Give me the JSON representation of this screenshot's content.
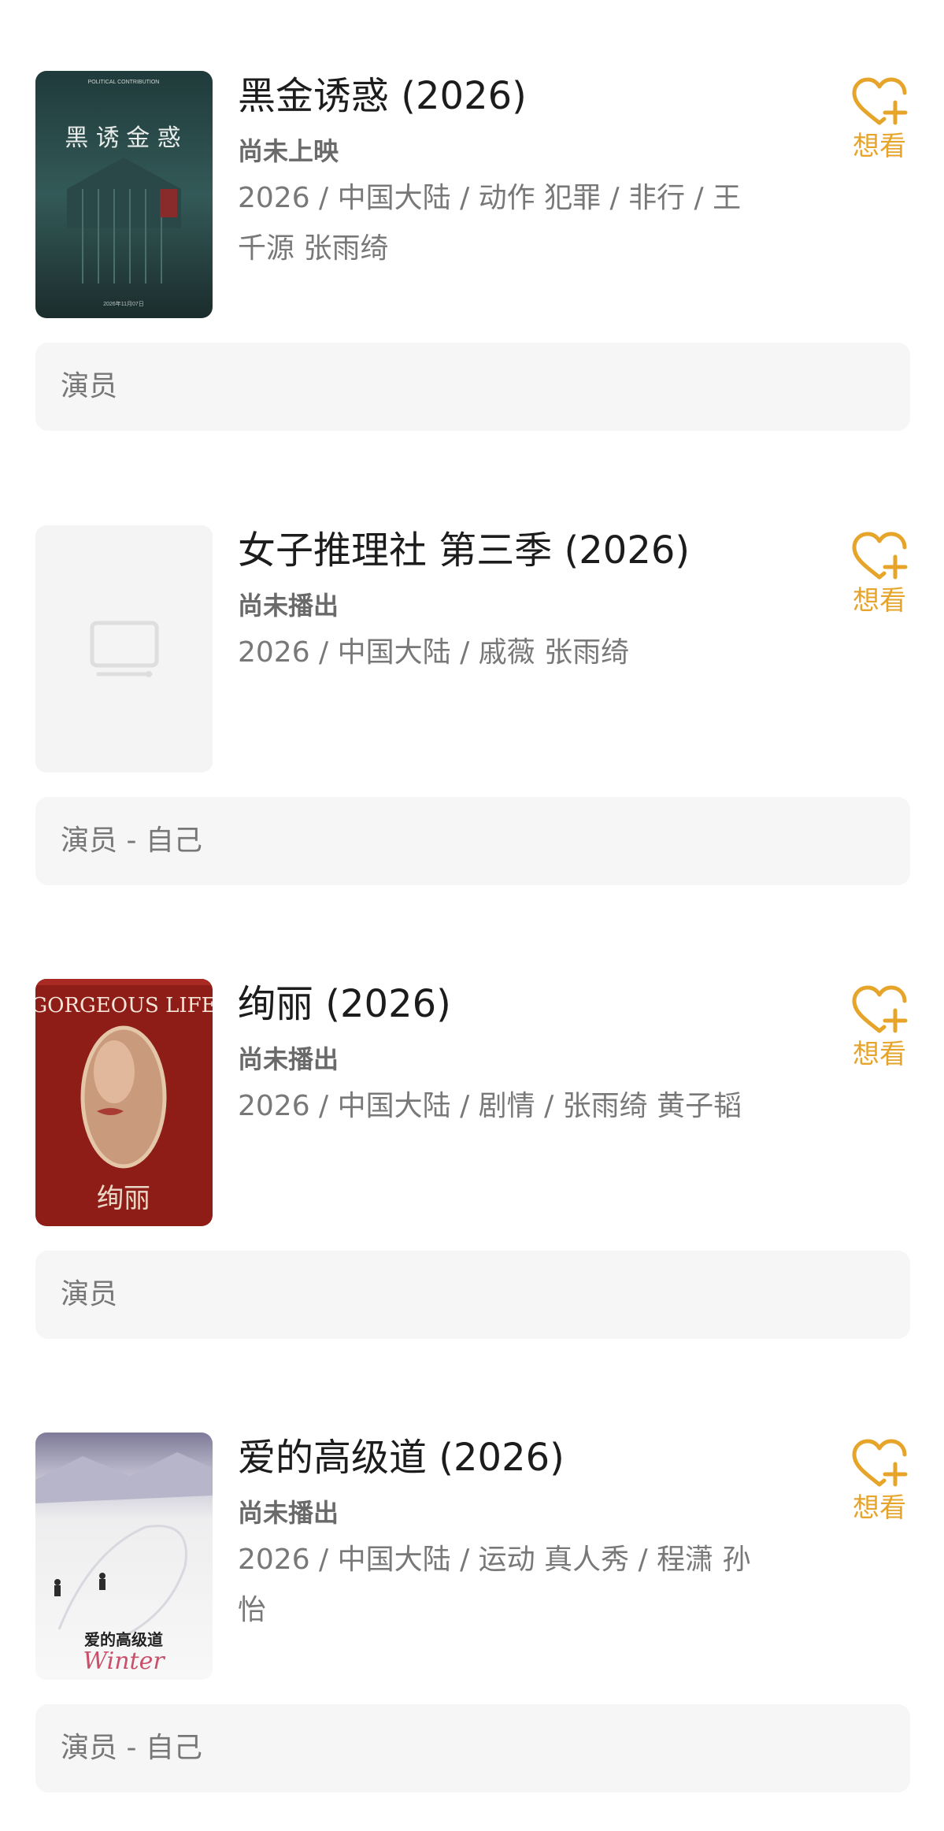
{
  "want_label": "想看",
  "accent_color": "#e6a52a",
  "works": [
    {
      "title": "黑金诱惑 (2026)",
      "status": "尚未上映",
      "info": "2026 / 中国大陆 / 动作 犯罪 / 非行 / 王千源 张雨绮",
      "role": "演员",
      "poster": "dark teal movie poster",
      "poster_text": {
        "top": "POLITICAL CONTRIBUTION",
        "title_left": "黑 诱",
        "title_right": "金 惑",
        "date": "2026年11月07日"
      }
    },
    {
      "title": "女子推理社 第三季 (2026)",
      "status": "尚未播出",
      "info": "2026 / 中国大陆 / 戚薇 张雨绮",
      "role": "演员 - 自己",
      "poster": "tv-placeholder-icon"
    },
    {
      "title": "绚丽 (2026)",
      "status": "尚未播出",
      "info": "2026 / 中国大陆 / 剧情 / 张雨绮 黄子韬",
      "role": "演员",
      "poster": "red magazine cover",
      "poster_text": {
        "top": "GORGEOUS LIFE",
        "bottom": "绚丽"
      }
    },
    {
      "title": "爱的高级道 (2026)",
      "status": "尚未播出",
      "info": "2026 / 中国大陆 / 运动 真人秀 / 程潇 孙怡",
      "role": "演员 - 自己",
      "poster": "snowy ski slope",
      "poster_text": {
        "title": "爱的高级道",
        "script": "Winter"
      }
    }
  ]
}
